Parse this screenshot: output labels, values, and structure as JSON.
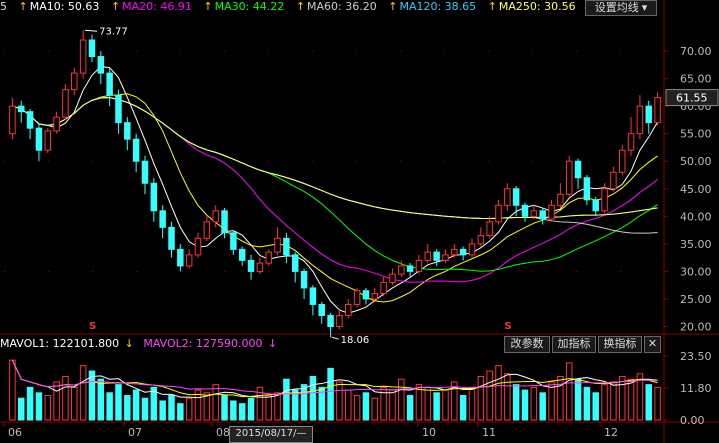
{
  "ma_bar": {
    "partial": "5",
    "ma10": {
      "label": "MA10: 50.63",
      "arrow": "↑",
      "color": "#ffffff"
    },
    "ma20": {
      "label": "MA20: 46.91",
      "arrow": "↑",
      "color": "#ff00ff"
    },
    "ma30": {
      "label": "MA30: 44.22",
      "arrow": "↑",
      "color": "#00ff00"
    },
    "ma60": {
      "label": "MA60: 36.20",
      "arrow": "↑",
      "color": "#cccccc"
    },
    "ma120": {
      "label": "MA120: 38.65",
      "arrow": "↑",
      "color": "#33ccff"
    },
    "ma250": {
      "label": "MA250: 30.56",
      "arrow": "↑",
      "color": "#ffff66"
    },
    "arrow_color": "#ffcc00"
  },
  "settings_button": "设置均线",
  "settings_arrow": "▾",
  "price_panel": {
    "ticks": [
      "70.00",
      "65.00",
      "60.00",
      "55.00",
      "50.00",
      "45.00",
      "40.00",
      "35.00",
      "30.00",
      "25.00",
      "20.00"
    ],
    "tick_values": [
      70,
      65,
      60,
      55,
      50,
      45,
      40,
      35,
      30,
      25,
      20
    ],
    "current_price": "61.55",
    "high_label": "73.77",
    "low_label": "18.06",
    "markers": [
      "S",
      "S"
    ]
  },
  "volume_panel": {
    "mavol1": "MAVOL1: 122101.800",
    "mavol2": "MAVOL2: 127590.000",
    "arrow": "↓",
    "buttons": {
      "change_params": "改参数",
      "add_indicator": "加指标",
      "switch_indicator": "换指标",
      "close": "✕"
    },
    "ticks": [
      "23.50",
      "11.80",
      "0.00"
    ],
    "tick_values": [
      23.5,
      11.8,
      0
    ]
  },
  "x_axis": {
    "labels": [
      "06",
      "07",
      "08",
      "10",
      "11",
      "12"
    ],
    "date_box": "2015/08/17/—"
  },
  "colors": {
    "up": "#ff3333",
    "down": "#33ffff",
    "grid": "#8a0000",
    "ma5": "#ffffff",
    "ma10": "#ffff00",
    "ma20": "#ff00ff",
    "ma30": "#00ff00",
    "ma60": "#cccccc",
    "ma120": "#33ccff",
    "ma250": "#ffff66"
  },
  "chart_data": {
    "type": "candlestick",
    "y_range": [
      19,
      76
    ],
    "candles": [
      [
        55.0,
        60.0,
        61.5,
        54.0
      ],
      [
        60.0,
        59.0,
        61.0,
        57.0
      ],
      [
        59.0,
        56.0,
        59.5,
        54.0
      ],
      [
        56.0,
        52.0,
        57.0,
        50.0
      ],
      [
        52.0,
        55.5,
        56.0,
        51.5
      ],
      [
        55.5,
        58.0,
        59.0,
        55.0
      ],
      [
        58.0,
        63.0,
        64.0,
        57.5
      ],
      [
        63.0,
        66.0,
        67.0,
        62.0
      ],
      [
        66.0,
        72.0,
        73.77,
        65.0
      ],
      [
        72.0,
        69.0,
        73.0,
        68.0
      ],
      [
        69.0,
        66.0,
        70.0,
        64.0
      ],
      [
        66.0,
        62.0,
        67.0,
        60.0
      ],
      [
        62.0,
        57.0,
        63.0,
        55.0
      ],
      [
        57.0,
        54.0,
        58.0,
        52.0
      ],
      [
        54.0,
        50.0,
        55.0,
        48.0
      ],
      [
        50.0,
        46.0,
        51.0,
        44.0
      ],
      [
        46.0,
        41.0,
        47.0,
        39.0
      ],
      [
        41.0,
        38.0,
        42.0,
        36.0
      ],
      [
        38.0,
        34.0,
        39.0,
        32.5
      ],
      [
        34.0,
        31.0,
        35.0,
        30.0
      ],
      [
        31.0,
        33.0,
        34.0,
        30.5
      ],
      [
        33.0,
        36.0,
        37.0,
        32.5
      ],
      [
        36.0,
        39.0,
        40.0,
        35.5
      ],
      [
        39.0,
        41.0,
        42.0,
        38.0
      ],
      [
        41.0,
        37.0,
        41.5,
        36.0
      ],
      [
        37.0,
        34.0,
        37.5,
        33.0
      ],
      [
        34.0,
        32.0,
        34.5,
        31.0
      ],
      [
        32.0,
        30.0,
        33.0,
        28.5
      ],
      [
        30.0,
        31.5,
        32.5,
        29.5
      ],
      [
        31.5,
        33.5,
        34.0,
        31.0
      ],
      [
        33.5,
        36.0,
        38.0,
        33.0
      ],
      [
        36.0,
        33.0,
        37.0,
        31.5
      ],
      [
        33.0,
        30.0,
        33.5,
        28.0
      ],
      [
        30.0,
        27.0,
        30.5,
        25.0
      ],
      [
        27.0,
        24.0,
        27.5,
        22.0
      ],
      [
        24.0,
        22.0,
        24.5,
        20.5
      ],
      [
        22.0,
        20.0,
        22.5,
        18.06
      ],
      [
        20.0,
        22.0,
        23.0,
        19.5
      ],
      [
        22.0,
        24.0,
        25.0,
        21.5
      ],
      [
        24.0,
        26.5,
        27.0,
        23.5
      ],
      [
        26.5,
        25.0,
        27.0,
        24.0
      ],
      [
        25.0,
        26.0,
        27.0,
        24.5
      ],
      [
        26.0,
        28.0,
        29.0,
        25.5
      ],
      [
        28.0,
        29.5,
        30.5,
        27.5
      ],
      [
        29.5,
        31.0,
        32.0,
        29.0
      ],
      [
        31.0,
        30.0,
        31.5,
        29.0
      ],
      [
        30.0,
        32.0,
        33.0,
        29.5
      ],
      [
        32.0,
        33.5,
        35.0,
        31.5
      ],
      [
        33.5,
        32.0,
        34.0,
        31.0
      ],
      [
        32.0,
        33.0,
        34.0,
        31.5
      ],
      [
        33.0,
        34.0,
        35.0,
        32.5
      ],
      [
        34.0,
        33.0,
        34.5,
        32.0
      ],
      [
        33.0,
        35.0,
        36.0,
        32.5
      ],
      [
        35.0,
        36.5,
        38.0,
        34.5
      ],
      [
        36.5,
        39.0,
        40.0,
        36.0
      ],
      [
        39.0,
        42.0,
        43.0,
        38.5
      ],
      [
        42.0,
        45.0,
        46.0,
        41.0
      ],
      [
        45.0,
        42.0,
        45.5,
        40.0
      ],
      [
        42.0,
        40.0,
        42.5,
        39.0
      ],
      [
        40.0,
        41.0,
        42.0,
        39.5
      ],
      [
        41.0,
        39.5,
        41.5,
        38.5
      ],
      [
        39.5,
        42.0,
        43.0,
        39.0
      ],
      [
        42.0,
        44.0,
        46.0,
        41.5
      ],
      [
        44.0,
        50.0,
        51.0,
        43.5
      ],
      [
        50.0,
        47.0,
        50.5,
        45.0
      ],
      [
        47.0,
        43.0,
        47.5,
        42.0
      ],
      [
        43.0,
        41.0,
        43.5,
        40.0
      ],
      [
        41.0,
        45.0,
        46.0,
        40.5
      ],
      [
        45.0,
        48.0,
        49.0,
        44.5
      ],
      [
        48.0,
        52.0,
        53.0,
        47.5
      ],
      [
        52.0,
        55.0,
        58.0,
        51.0
      ],
      [
        55.0,
        60.0,
        62.0,
        54.0
      ],
      [
        60.0,
        57.0,
        61.0,
        55.0
      ],
      [
        57.0,
        61.55,
        62.5,
        56.5
      ]
    ],
    "volumes": [
      22,
      8,
      12,
      10,
      9,
      14,
      16,
      12,
      20,
      18,
      15,
      10,
      13,
      9,
      11,
      8,
      12,
      7,
      9,
      6,
      8,
      11,
      10,
      13,
      9,
      7,
      6,
      8,
      12,
      9,
      10,
      15,
      11,
      13,
      16,
      12,
      19,
      14,
      11,
      9,
      10,
      8,
      12,
      11,
      15,
      9,
      13,
      12,
      10,
      11,
      14,
      9,
      12,
      16,
      18,
      20,
      17,
      13,
      11,
      12,
      10,
      14,
      16,
      21,
      15,
      12,
      10,
      13,
      14,
      16,
      15,
      17,
      13,
      12
    ]
  }
}
